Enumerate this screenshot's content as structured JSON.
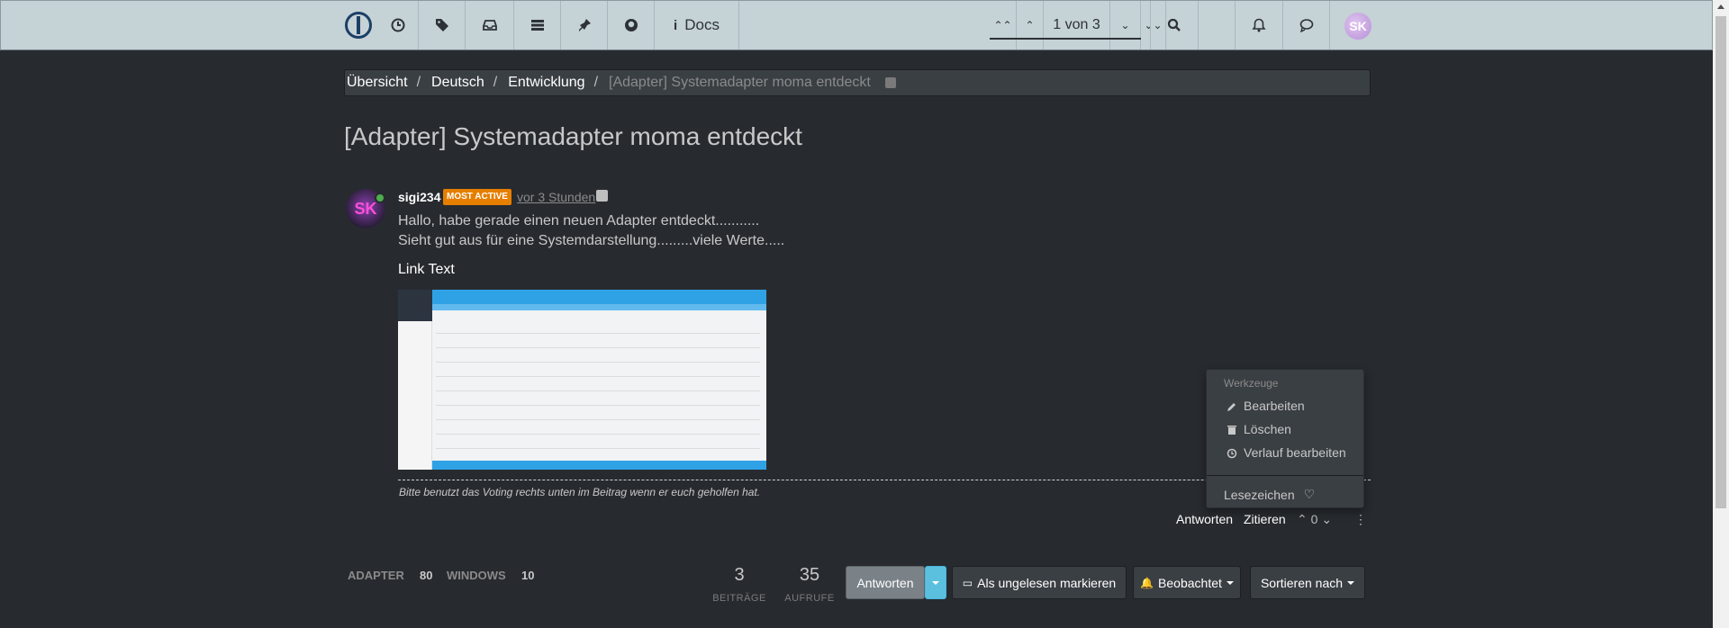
{
  "navbar": {
    "docs_label": "Docs",
    "pagination_text": "1 von 3",
    "avatar_initials": "SK",
    "icons": [
      "logo-icon",
      "clock-icon",
      "tags-icon",
      "inbox-icon",
      "list-icon",
      "pin-icon",
      "github-icon",
      "info-icon",
      "double-up-icon",
      "up-icon",
      "down-icon",
      "double-down-icon",
      "search-icon",
      "bell-icon",
      "chat-icon"
    ]
  },
  "breadcrumb": {
    "items": [
      "Übersicht",
      "Deutsch",
      "Entwicklung"
    ],
    "sep": "/",
    "active": "[Adapter] Systemadapter moma entdeckt"
  },
  "topic": {
    "title": "[Adapter] Systemadapter moma entdeckt"
  },
  "post": {
    "avatar_initials": "SK",
    "author": "sigi234",
    "badge": "MOST ACTIVE",
    "time": "vor 3 Stunden",
    "line1": "Hallo, habe gerade einen neuen Adapter entdeckt...........",
    "line2": "Sieht gut aus für eine Systemdarstellung.........viele Werte.....",
    "link_text": "Link Text",
    "signature": "Bitte benutzt das Voting rechts unten im Beitrag wenn er euch geholfen hat.",
    "reply_label": "Antworten",
    "quote_label": "Zitieren",
    "votes": "0"
  },
  "tools_menu": {
    "header": "Werkzeuge",
    "edit": "Bearbeiten",
    "delete": "Löschen",
    "history": "Verlauf bearbeiten",
    "bookmark": "Lesezeichen"
  },
  "bottom": {
    "tags": [
      {
        "name": "ADAPTER",
        "count": "80"
      },
      {
        "name": "WINDOWS",
        "count": "10"
      }
    ],
    "posts_count": "3",
    "posts_label": "BEITRÄGE",
    "views_count": "35",
    "views_label": "AUFRUFE",
    "reply_button": "Antworten",
    "mark_unread_button": "Als ungelesen markieren",
    "watch_button": "Beobachtet",
    "sort_button": "Sortieren nach"
  }
}
